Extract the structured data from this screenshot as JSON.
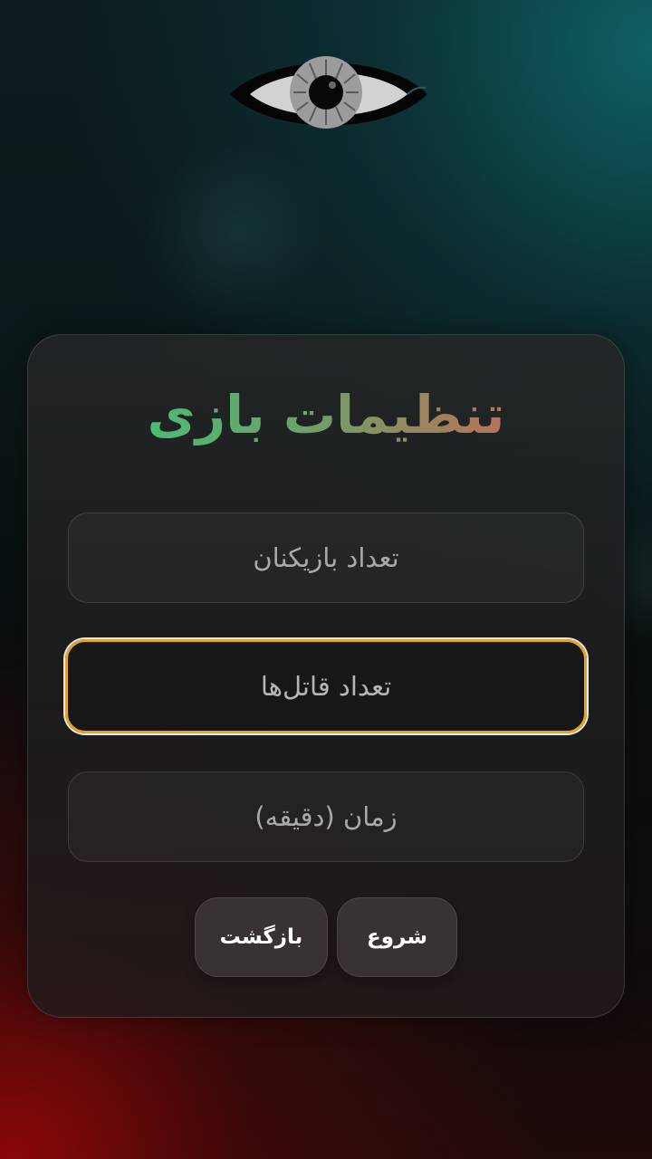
{
  "header": {
    "icon": "eye-icon"
  },
  "settings": {
    "title": "تنظیمات بازی",
    "players_placeholder": "تعداد بازیکنان",
    "killers_placeholder": "تعداد قاتل‌ها",
    "time_placeholder": "زمان (دقیقه)",
    "start_label": "شروع",
    "back_label": "بازگشت"
  },
  "colors": {
    "accent_focus": "#e5a421",
    "title_gradient_start": "#2ed27a",
    "title_gradient_end": "#d9604a"
  }
}
